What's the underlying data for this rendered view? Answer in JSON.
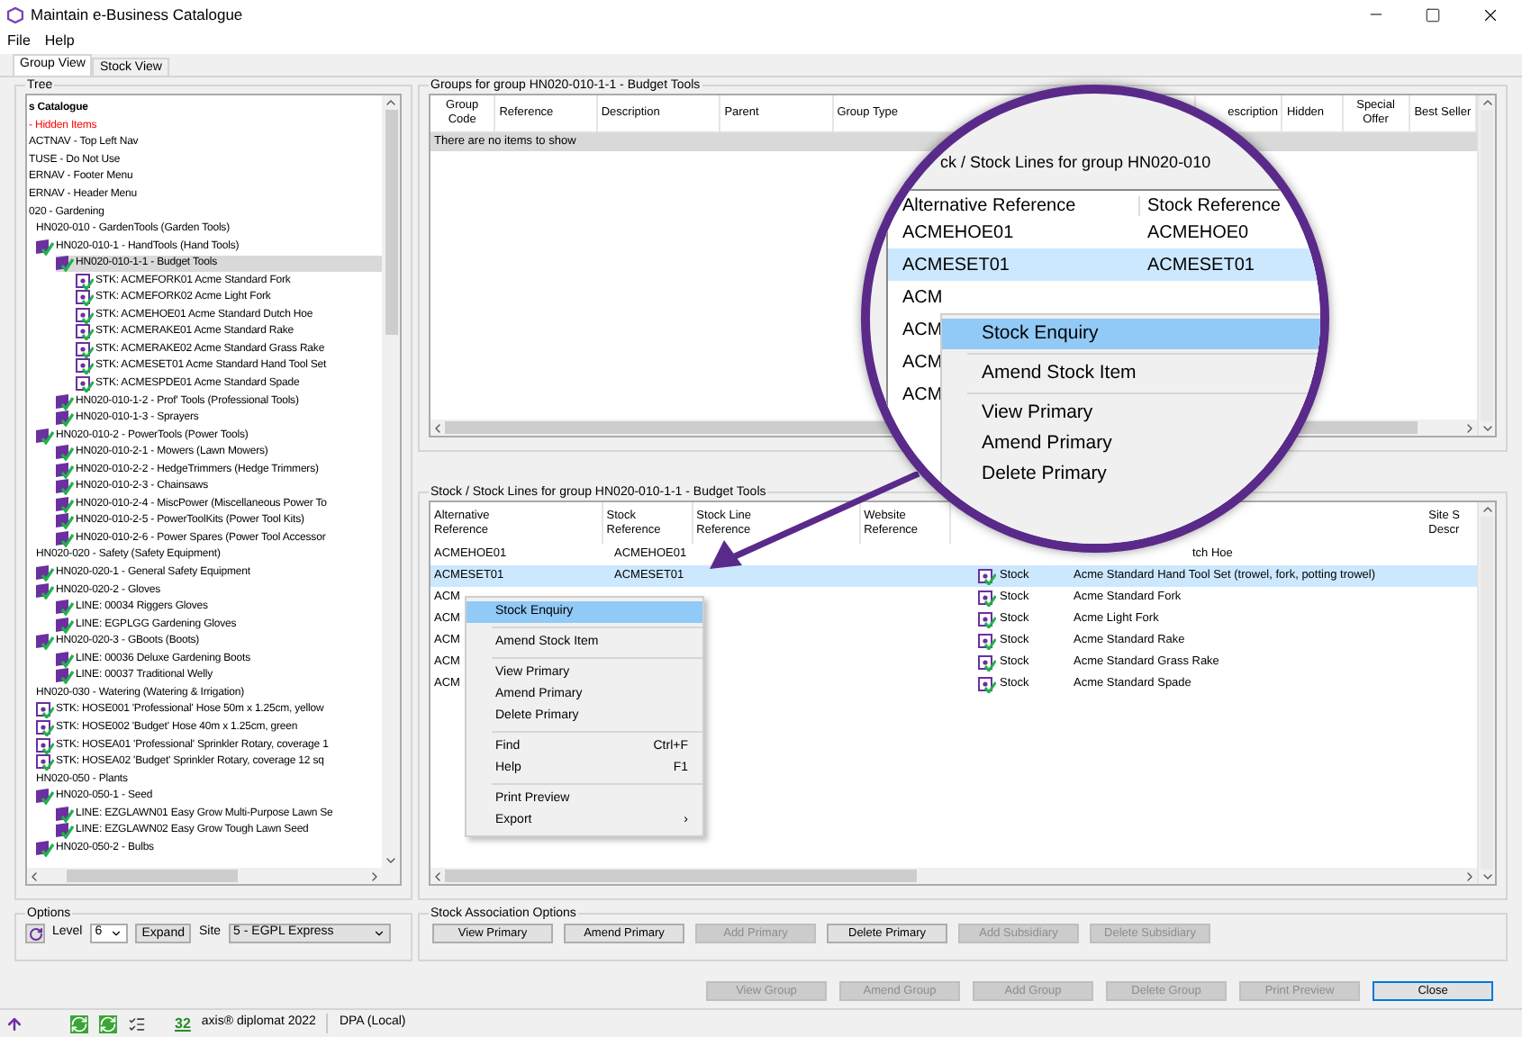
{
  "window": {
    "title": "Maintain e-Business Catalogue"
  },
  "menu": [
    "File",
    "Help"
  ],
  "tabs": [
    {
      "label": "Group View",
      "selected": true
    },
    {
      "label": "Stock View",
      "selected": false
    }
  ],
  "tree": {
    "title": "Tree",
    "items": [
      {
        "label": "s Catalogue",
        "kind": "root",
        "selected": false,
        "children": [
          {
            "label": "- Hidden Items",
            "kind": "hidden",
            "selected": false
          },
          {
            "label": "ACTNAV - Top Left Nav",
            "kind": "plain",
            "selected": false
          },
          {
            "label": "TUSE - Do Not Use",
            "kind": "plain",
            "selected": false
          },
          {
            "label": "ERNAV - Footer Menu",
            "kind": "plain",
            "selected": false
          },
          {
            "label": "ERNAV - Header Menu",
            "kind": "plain",
            "selected": false
          },
          {
            "label": "020 - Gardening",
            "kind": "plain",
            "selected": false,
            "children": [
              {
                "label": "HN020-010 - GardenTools (Garden Tools)",
                "kind": "plain",
                "selected": false,
                "children": [
                  {
                    "label": "HN020-010-1 - HandTools (Hand Tools)",
                    "kind": "group",
                    "selected": false,
                    "children": [
                      {
                        "label": "HN020-010-1-1 - Budget Tools",
                        "kind": "group",
                        "selected": true,
                        "children": [
                          {
                            "label": "STK: ACMEFORK01 Acme Standard Fork",
                            "kind": "stock",
                            "selected": false
                          },
                          {
                            "label": "STK: ACMEFORK02 Acme Light Fork",
                            "kind": "stock",
                            "selected": false
                          },
                          {
                            "label": "STK: ACMEHOE01 Acme Standard Dutch Hoe",
                            "kind": "stock",
                            "selected": false
                          },
                          {
                            "label": "STK: ACMERAKE01 Acme Standard Rake",
                            "kind": "stock",
                            "selected": false
                          },
                          {
                            "label": "STK: ACMERAKE02 Acme Standard Grass Rake",
                            "kind": "stock",
                            "selected": false
                          },
                          {
                            "label": "STK: ACMESET01 Acme Standard Hand Tool Set",
                            "kind": "stock",
                            "selected": false
                          },
                          {
                            "label": "STK: ACMESPDE01 Acme Standard Spade",
                            "kind": "stock",
                            "selected": false
                          }
                        ]
                      },
                      {
                        "label": "HN020-010-1-2 - Prof' Tools (Professional Tools)",
                        "kind": "group",
                        "selected": false
                      },
                      {
                        "label": "HN020-010-1-3 - Sprayers",
                        "kind": "group",
                        "selected": false
                      }
                    ]
                  },
                  {
                    "label": "HN020-010-2 - PowerTools (Power Tools)",
                    "kind": "group",
                    "selected": false,
                    "children": [
                      {
                        "label": "HN020-010-2-1 - Mowers (Lawn Mowers)",
                        "kind": "group",
                        "selected": false
                      },
                      {
                        "label": "HN020-010-2-2 - HedgeTrimmers (Hedge Trimmers)",
                        "kind": "group",
                        "selected": false
                      },
                      {
                        "label": "HN020-010-2-3 - Chainsaws",
                        "kind": "group",
                        "selected": false
                      },
                      {
                        "label": "HN020-010-2-4 - MiscPower (Miscellaneous Power To",
                        "kind": "group",
                        "selected": false
                      },
                      {
                        "label": "HN020-010-2-5 - PowerToolKits (Power Tool Kits)",
                        "kind": "group",
                        "selected": false
                      },
                      {
                        "label": "HN020-010-2-6 - Power Spares (Power Tool Accessor",
                        "kind": "group",
                        "selected": false
                      }
                    ]
                  }
                ]
              },
              {
                "label": "HN020-020 - Safety (Safety Equipment)",
                "kind": "plain",
                "selected": false,
                "children": [
                  {
                    "label": "HN020-020-1 - General Safety Equipment",
                    "kind": "group",
                    "selected": false
                  },
                  {
                    "label": "HN020-020-2 - Gloves",
                    "kind": "group",
                    "selected": false,
                    "children": [
                      {
                        "label": "LINE: 00034 Riggers Gloves",
                        "kind": "line",
                        "selected": false
                      },
                      {
                        "label": "LINE: EGPLGG Gardening Gloves",
                        "kind": "line",
                        "selected": false
                      }
                    ]
                  },
                  {
                    "label": "HN020-020-3 - GBoots (Boots)",
                    "kind": "group",
                    "selected": false,
                    "children": [
                      {
                        "label": "LINE: 00036 Deluxe Gardening Boots",
                        "kind": "line",
                        "selected": false
                      },
                      {
                        "label": "LINE: 00037 Traditional Welly",
                        "kind": "line",
                        "selected": false
                      }
                    ]
                  }
                ]
              },
              {
                "label": "HN020-030 - Watering (Watering & Irrigation)",
                "kind": "plain",
                "selected": false,
                "children": [
                  {
                    "label": "STK: HOSE001 'Professional' Hose 50m x 1.25cm, yellow",
                    "kind": "stock",
                    "selected": false
                  },
                  {
                    "label": "STK: HOSE002 'Budget' Hose 40m x 1.25cm, green",
                    "kind": "stock",
                    "selected": false
                  },
                  {
                    "label": "STK: HOSEA01 'Professional' Sprinkler Rotary, coverage 1",
                    "kind": "stock",
                    "selected": false
                  },
                  {
                    "label": "STK: HOSEA02 'Budget' Sprinkler Rotary, coverage 12 sq",
                    "kind": "stock",
                    "selected": false
                  }
                ]
              },
              {
                "label": "HN020-050 - Plants",
                "kind": "plain",
                "selected": false,
                "children": [
                  {
                    "label": "HN020-050-1 - Seed",
                    "kind": "group",
                    "selected": false,
                    "children": [
                      {
                        "label": "LINE: EZGLAWN01 Easy Grow Multi-Purpose Lawn Se",
                        "kind": "line",
                        "selected": false
                      },
                      {
                        "label": "LINE: EZGLAWN02 Easy Grow Tough Lawn Seed",
                        "kind": "line",
                        "selected": false
                      }
                    ]
                  },
                  {
                    "label": "HN020-050-2 - Bulbs",
                    "kind": "group",
                    "selected": false
                  }
                ]
              }
            ]
          }
        ]
      }
    ]
  },
  "groups_panel": {
    "title": "Groups for group HN020-010-1-1 - Budget Tools",
    "columns": [
      "Group Code",
      "Reference",
      "Description",
      "Parent",
      "Group Type",
      "escription",
      "Hidden",
      "Special Offer",
      "Best Seller"
    ],
    "empty_text": "There are no items to show"
  },
  "stock_panel": {
    "title": "Stock / Stock Lines for group HN020-010-1-1 - Budget Tools",
    "columns": [
      "Alternative Reference",
      "Stock Reference",
      "Stock Line Reference",
      "Website Reference",
      "Site S Descr"
    ],
    "rows": [
      {
        "alt_ref": "ACMEHOE01",
        "stock_ref": "ACMEHOE01",
        "description": "tch Hoe",
        "selected": false
      },
      {
        "alt_ref": "ACMESET01",
        "stock_ref": "ACMESET01",
        "type": "Stock",
        "description": "Acme Standard Hand Tool Set (trowel, fork, potting trowel)",
        "selected": true
      },
      {
        "alt_ref": "ACM",
        "type": "Stock",
        "description": "Acme Standard Fork",
        "selected": false
      },
      {
        "alt_ref": "ACM",
        "type": "Stock",
        "description": "Acme Light Fork",
        "selected": false
      },
      {
        "alt_ref": "ACM",
        "type": "Stock",
        "description": "Acme Standard Rake",
        "selected": false
      },
      {
        "alt_ref": "ACM",
        "type": "Stock",
        "description": "Acme Standard Grass Rake",
        "selected": false
      },
      {
        "alt_ref": "ACM",
        "type": "Stock",
        "description": "Acme Standard Spade",
        "selected": false
      }
    ]
  },
  "context_menu": [
    {
      "kind": "item",
      "label": "Stock Enquiry",
      "selected": true
    },
    {
      "kind": "separator"
    },
    {
      "kind": "item",
      "label": "Amend Stock Item",
      "selected": false
    },
    {
      "kind": "separator"
    },
    {
      "kind": "item",
      "label": "View Primary",
      "selected": false
    },
    {
      "kind": "item",
      "label": "Amend Primary",
      "selected": false
    },
    {
      "kind": "item",
      "label": "Delete Primary",
      "selected": false
    },
    {
      "kind": "separator"
    },
    {
      "kind": "item",
      "label": "Find",
      "shortcut": "Ctrl+F",
      "selected": false
    },
    {
      "kind": "item",
      "label": "Help",
      "shortcut": "F1",
      "selected": false
    },
    {
      "kind": "separator"
    },
    {
      "kind": "item",
      "label": "Print Preview",
      "selected": false
    },
    {
      "kind": "submenu",
      "label": "Export",
      "arrow": "›",
      "selected": false
    }
  ],
  "magnifier": {
    "title": "ck / Stock Lines for group HN020-010",
    "columns": [
      "Alternative Reference",
      "Stock Reference"
    ],
    "rows": [
      {
        "cells": [
          "ACMEHOE01",
          "ACMEHOE0"
        ],
        "selected": false
      },
      {
        "cells": [
          "ACMESET01",
          "ACMESET01"
        ],
        "selected": true
      },
      {
        "cells": [
          "ACM"
        ],
        "selected": false
      },
      {
        "cells": [
          "ACM"
        ],
        "selected": false
      },
      {
        "cells": [
          "ACM"
        ],
        "selected": false
      },
      {
        "cells": [
          "ACM"
        ],
        "selected": false
      }
    ],
    "menu": [
      {
        "kind": "item",
        "label": "Stock Enquiry",
        "selected": true
      },
      {
        "kind": "separator"
      },
      {
        "kind": "item",
        "label": "Amend Stock Item",
        "selected": false
      },
      {
        "kind": "separator"
      },
      {
        "kind": "item",
        "label": "View Primary",
        "selected": false
      },
      {
        "kind": "item",
        "label": "Amend Primary",
        "selected": false
      },
      {
        "kind": "item",
        "label": "Delete Primary",
        "selected": false
      }
    ]
  },
  "options": {
    "title": "Options",
    "level_label": "Level",
    "level_value": "6",
    "expand": "Expand",
    "site_label": "Site",
    "site_value": "5 - EGPL Express"
  },
  "association": {
    "title": "Stock Association Options",
    "buttons": [
      {
        "label": "View Primary",
        "disabled": false
      },
      {
        "label": "Amend Primary",
        "disabled": false
      },
      {
        "label": "Add Primary",
        "disabled": true
      },
      {
        "label": "Delete Primary",
        "disabled": false
      },
      {
        "label": "Add Subsidiary",
        "disabled": true
      },
      {
        "label": "Delete Subsidiary",
        "disabled": true
      }
    ]
  },
  "footer_buttons": [
    {
      "label": "View Group",
      "disabled": true,
      "default": false
    },
    {
      "label": "Amend Group",
      "disabled": true,
      "default": false
    },
    {
      "label": "Add Group",
      "disabled": true,
      "default": false
    },
    {
      "label": "Delete Group",
      "disabled": true,
      "default": false
    },
    {
      "label": "Print Preview",
      "disabled": true,
      "default": false
    },
    {
      "label": "Close",
      "disabled": false,
      "default": true
    }
  ],
  "status_bar": {
    "count": "32",
    "product": "axis® diplomat 2022",
    "connection": "DPA (Local)"
  }
}
